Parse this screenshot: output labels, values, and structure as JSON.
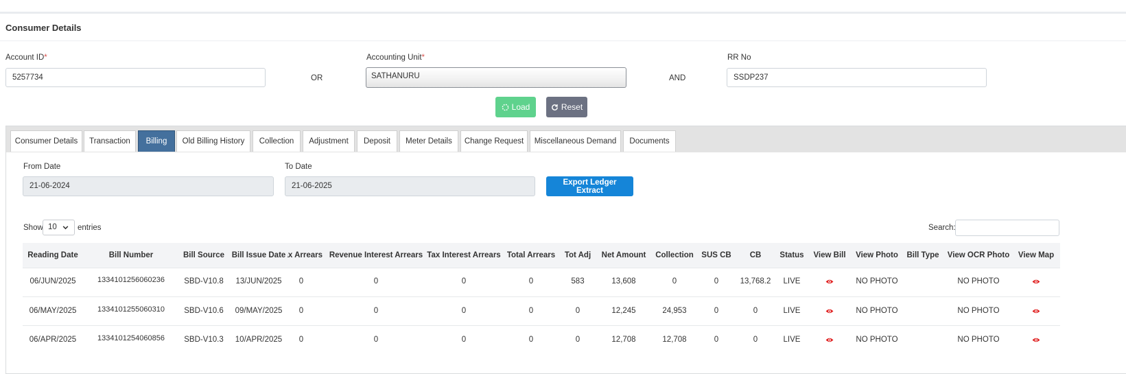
{
  "header": {
    "title": "Consumer Details"
  },
  "form": {
    "account_id_label": "Account ID",
    "required_mark": "*",
    "account_id_value": "5257734",
    "or_text": "OR",
    "accounting_unit_label": "Accounting Unit",
    "accounting_unit_value": "SATHANURU",
    "and_text": "AND",
    "rr_no_label": "RR No",
    "rr_no_value": "SSDP237",
    "load_label": "Load",
    "reset_label": "Reset"
  },
  "tabs": [
    {
      "label": "Consumer Details"
    },
    {
      "label": "Transaction"
    },
    {
      "label": "Billing",
      "active": true
    },
    {
      "label": "Old Billing History"
    },
    {
      "label": "Collection"
    },
    {
      "label": "Adjustment"
    },
    {
      "label": "Deposit"
    },
    {
      "label": "Meter Details"
    },
    {
      "label": "Change Request"
    },
    {
      "label": "Miscellaneous Demand"
    },
    {
      "label": "Documents"
    }
  ],
  "billing": {
    "from_date_label": "From Date",
    "from_date_value": "21-06-2024",
    "to_date_label": "To Date",
    "to_date_value": "21-06-2025",
    "export_label": "Export Ledger Extract",
    "show_label": "Show",
    "entries_value": "10",
    "entries_label": "entries",
    "search_label": "Search:"
  },
  "table": {
    "columns": [
      "Reading Date",
      "Bill Number",
      "Bill Source",
      "Bill Issue Date",
      "Tax Arrears",
      "Revenue Interest Arrears",
      "Tax Interest Arrears",
      "Total Arrears",
      "Tot Adj",
      "Net Amount",
      "Collection",
      "SUS CB",
      "CB",
      "Status",
      "View Bill",
      "View Photo",
      "Bill Type",
      "View OCR Photo",
      "View Map"
    ],
    "rows": [
      {
        "reading_date": "06/JUN/2025",
        "bill_number": "1334101256060236",
        "bill_source": "SBD-V10.8",
        "bill_issue_date": "13/JUN/2025",
        "tax_arrears": "0",
        "revenue_interest_arrears": "0",
        "tax_interest_arrears": "0",
        "total_arrears": "0",
        "tot_adj": "583",
        "net_amount": "13,608",
        "collection": "0",
        "sus_cb": "0",
        "cb": "13,768.2",
        "status": "LIVE",
        "view_photo": "NO PHOTO",
        "bill_type": "",
        "view_ocr_photo": "NO PHOTO"
      },
      {
        "reading_date": "06/MAY/2025",
        "bill_number": "1334101255060310",
        "bill_source": "SBD-V10.6",
        "bill_issue_date": "09/MAY/2025",
        "tax_arrears": "0",
        "revenue_interest_arrears": "0",
        "tax_interest_arrears": "0",
        "total_arrears": "0",
        "tot_adj": "0",
        "net_amount": "12,245",
        "collection": "24,953",
        "sus_cb": "0",
        "cb": "0",
        "status": "LIVE",
        "view_photo": "NO PHOTO",
        "bill_type": "",
        "view_ocr_photo": "NO PHOTO"
      },
      {
        "reading_date": "06/APR/2025",
        "bill_number": "1334101254060856",
        "bill_source": "SBD-V10.3",
        "bill_issue_date": "10/APR/2025",
        "tax_arrears": "0",
        "revenue_interest_arrears": "0",
        "tax_interest_arrears": "0",
        "total_arrears": "0",
        "tot_adj": "0",
        "net_amount": "12,708",
        "collection": "12,708",
        "sus_cb": "0",
        "cb": "0",
        "status": "LIVE",
        "view_photo": "NO PHOTO",
        "bill_type": "",
        "view_ocr_photo": "NO PHOTO"
      }
    ]
  },
  "icons": {
    "view_bill": "eye-icon",
    "view_map": "eye-icon",
    "load": "spinner-icon",
    "reset": "refresh-icon",
    "entries": "chevron-down-icon"
  },
  "colors": {
    "active_tab": "#44709d",
    "load_button": "#5fd28d",
    "reset_button": "#6c7182",
    "export_button": "#1585d8",
    "required": "#d9534f",
    "eye": "#e02020"
  }
}
